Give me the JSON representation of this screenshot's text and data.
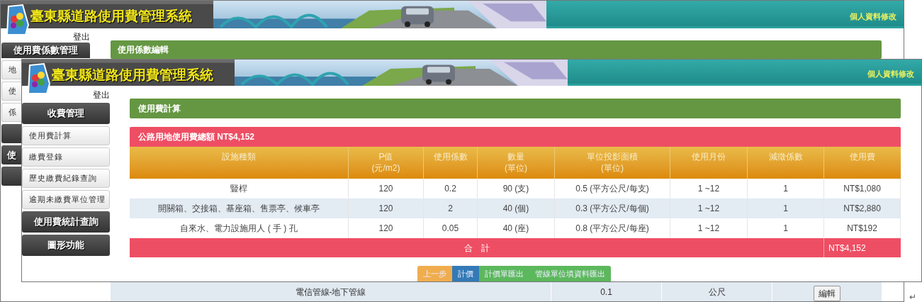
{
  "back_window": {
    "site_title": "臺東縣道路使用費管理系統",
    "profile_link": "個人資料修改",
    "logout": "登出",
    "sidebar": [
      {
        "kind": "section",
        "label": "使用費係數管理"
      },
      {
        "kind": "item",
        "label": "地"
      },
      {
        "kind": "item",
        "label": "使"
      },
      {
        "kind": "item",
        "label": "係"
      },
      {
        "kind": "section"
      },
      {
        "kind": "section",
        "label": "使"
      },
      {
        "kind": "section"
      }
    ],
    "panel_title": "使用係數編輯",
    "table_row": [
      "電信管線-地下管線",
      "0.1",
      "公尺"
    ],
    "edit_button": "編輯"
  },
  "front_window": {
    "site_title": "臺東縣道路使用費管理系統",
    "profile_link": "個人資料修改",
    "logout": "登出",
    "sidebar": [
      {
        "kind": "section",
        "label": "收費管理"
      },
      {
        "kind": "item",
        "label": "使用費計算"
      },
      {
        "kind": "item",
        "label": "繳費登錄"
      },
      {
        "kind": "item",
        "label": "歷史繳費紀錄查詢"
      },
      {
        "kind": "item",
        "label": "逾期未繳費單位管理"
      },
      {
        "kind": "section",
        "label": "使用費統計查詢"
      },
      {
        "kind": "section",
        "label": "圖形功能"
      }
    ],
    "panel_title": "使用費計算",
    "total_title": "公路用地使用費總額 NT$4,152",
    "table": {
      "columns": [
        {
          "label": "設施種類"
        },
        {
          "label": "P值",
          "unit": "(元/m2)"
        },
        {
          "label": "使用係數"
        },
        {
          "label": "數量",
          "unit": "(單位)"
        },
        {
          "label": "單位投影面積",
          "unit": "(單位)"
        },
        {
          "label": "使用月份"
        },
        {
          "label": "減徵係數"
        },
        {
          "label": "使用費"
        }
      ],
      "rows": [
        [
          "豎桿",
          "120",
          "0.2",
          "90 (支)",
          "0.5 (平方公尺/每支)",
          "1 ~12",
          "1",
          "NT$1,080"
        ],
        [
          "開關箱、交接箱、基座箱、售票亭、候車亭",
          "120",
          "2",
          "40 (個)",
          "0.3 (平方公尺/每個)",
          "1 ~12",
          "1",
          "NT$2,880"
        ],
        [
          "自來水、電力設施用人 ( 手 ) 孔",
          "120",
          "0.05",
          "40 (座)",
          "0.8 (平方公尺/每座)",
          "1 ~12",
          "1",
          "NT$192"
        ]
      ],
      "total": {
        "label": "合　計",
        "value": "NT$4,152"
      }
    },
    "buttons": [
      {
        "label": "上一步",
        "color": "#f0ad4e"
      },
      {
        "label": "計價",
        "color": "#337ab7"
      },
      {
        "label": "計價單匯出",
        "color": "#5cb85c"
      },
      {
        "label": "管線單位填資料匯出",
        "color": "#5cb85c"
      }
    ]
  },
  "return_mark": "↵"
}
